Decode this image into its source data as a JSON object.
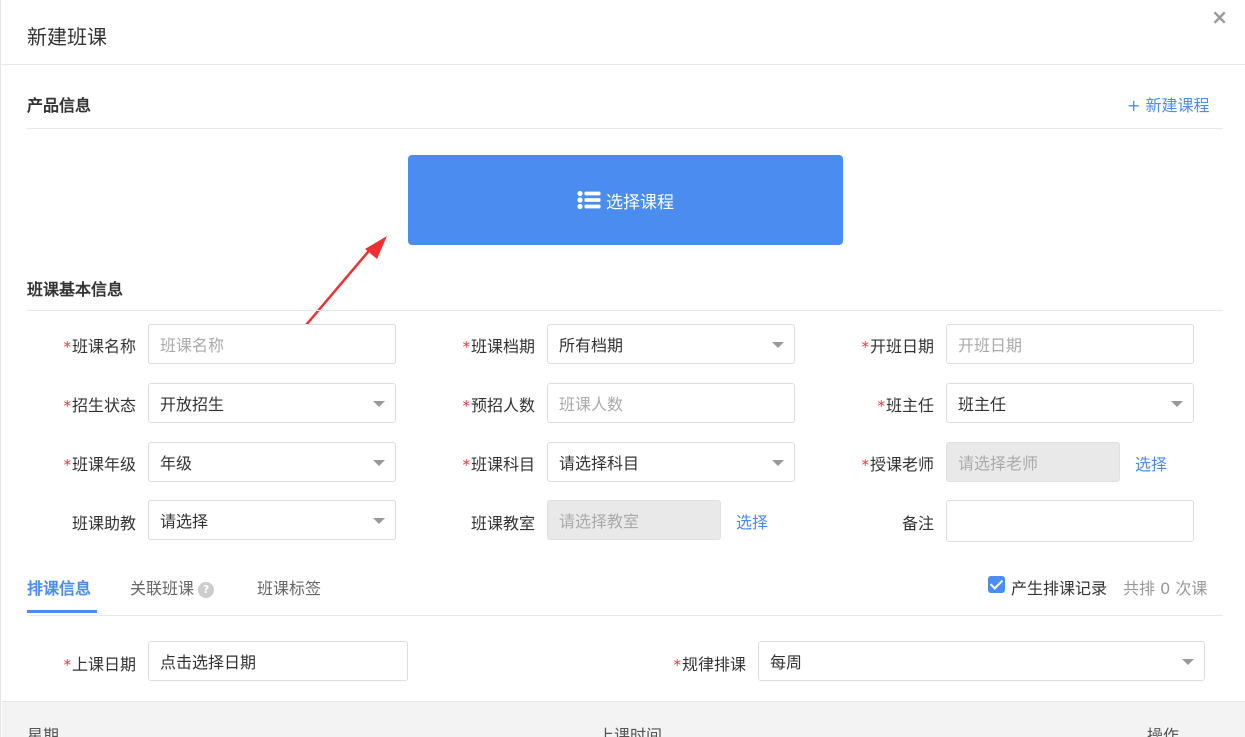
{
  "dialog": {
    "title": "新建班课",
    "close_icon": "×"
  },
  "product_section": {
    "title": "产品信息",
    "new_course_link": "+ 新建课程",
    "select_course_button": "选择课程"
  },
  "basic_section": {
    "title": "班课基本信息",
    "fields": {
      "class_name": {
        "label": "班课名称",
        "required": "*",
        "placeholder": "班课名称"
      },
      "class_term": {
        "label": "班课档期",
        "required": "*",
        "value": "所有档期"
      },
      "start_date": {
        "label": "开班日期",
        "required": "*",
        "placeholder": "开班日期"
      },
      "enroll_status": {
        "label": "招生状态",
        "required": "*",
        "value": "开放招生"
      },
      "expected_count": {
        "label": "预招人数",
        "required": "*",
        "placeholder": "班课人数"
      },
      "head_teacher": {
        "label": "班主任",
        "required": "*",
        "value": "班主任"
      },
      "grade": {
        "label": "班课年级",
        "required": "*",
        "value": "年级"
      },
      "subject": {
        "label": "班课科目",
        "required": "*",
        "value": "请选择科目"
      },
      "teacher": {
        "label": "授课老师",
        "required": "*",
        "placeholder": "请选择老师",
        "select_link": "选择"
      },
      "assistant": {
        "label": "班课助教",
        "value": "请选择"
      },
      "classroom": {
        "label": "班课教室",
        "placeholder": "请选择教室",
        "select_link": "选择"
      },
      "remark": {
        "label": "备注",
        "value": ""
      }
    }
  },
  "tabs": {
    "schedule": "排课信息",
    "related": "关联班课",
    "tags": "班课标签",
    "help_icon": "?"
  },
  "schedule_record": {
    "label": "产生排课记录",
    "summary": "共排 0 次课",
    "checked": true
  },
  "schedule_fields": {
    "date": {
      "label": "上课日期",
      "required": "*",
      "value": "点击选择日期"
    },
    "rule": {
      "label": "规律排课",
      "required": "*",
      "value": "每周"
    }
  },
  "table": {
    "columns": [
      "星期",
      "上课时间",
      "操作"
    ]
  },
  "colors": {
    "accent": "#4a8cf0",
    "required": "#e4393c",
    "annotation_arrow": "#f03030"
  }
}
